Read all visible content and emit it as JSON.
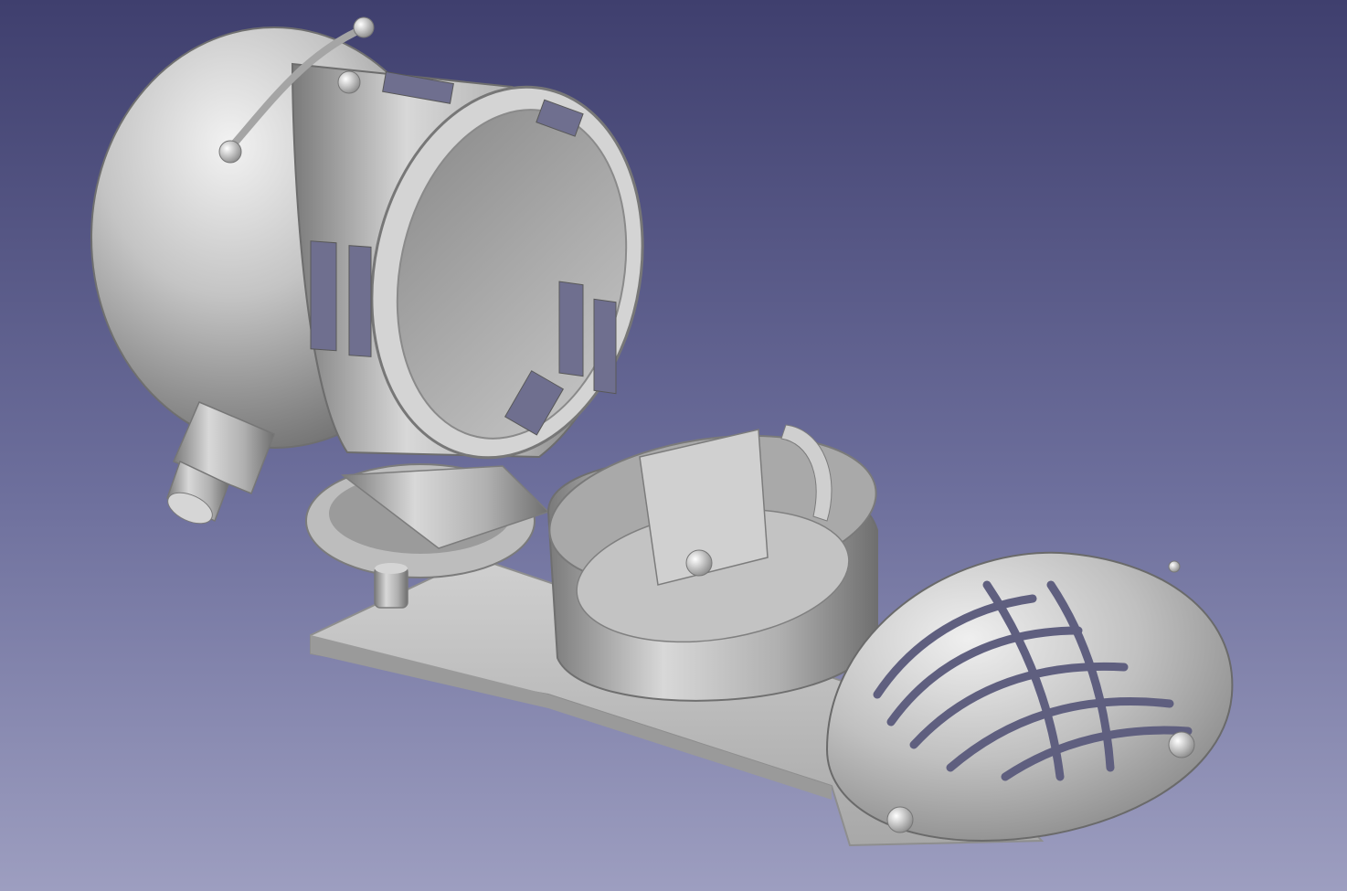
{
  "viewport": {
    "background_top": "#3f3f6e",
    "background_bottom": "#9d9ec0"
  },
  "model": {
    "part_color": "#b8b8b8",
    "parts": [
      "siren-housing",
      "housing-end-cap-nub",
      "mount-bracket",
      "base-plate",
      "rotor-cup",
      "vented-front-grille"
    ]
  }
}
